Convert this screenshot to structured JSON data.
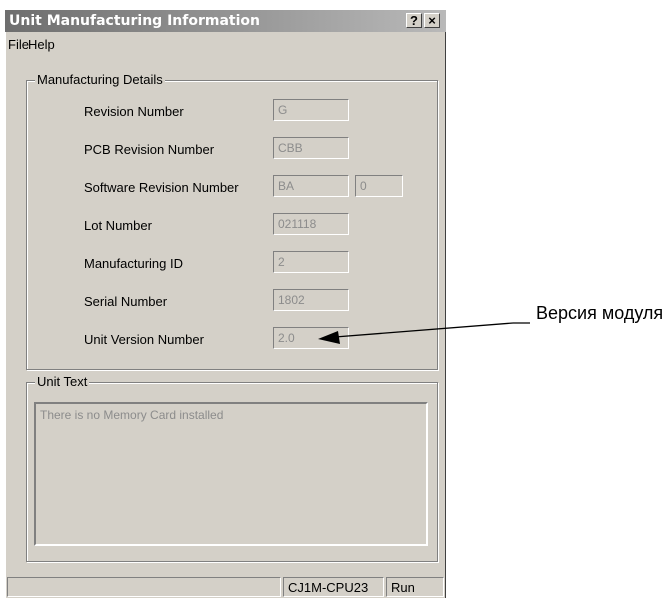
{
  "window": {
    "title": "Unit Manufacturing Information",
    "help_button": "?",
    "close_button": "×"
  },
  "menu": [
    "File",
    "Help"
  ],
  "manufacturing_details": {
    "legend": "Manufacturing Details",
    "rows": [
      {
        "label": "Revision Number",
        "value": "G"
      },
      {
        "label": "PCB Revision Number",
        "value": "CBB"
      },
      {
        "label": "Software Revision Number",
        "value": "BA",
        "extra_value": "0"
      },
      {
        "label": "Lot Number",
        "value": "021118"
      },
      {
        "label": "Manufacturing ID",
        "value": "2"
      },
      {
        "label": "Serial Number",
        "value": "1802"
      },
      {
        "label": "Unit Version Number",
        "value": "2.0"
      }
    ]
  },
  "unit_text": {
    "legend": "Unit Text",
    "content": "There is no Memory Card installed"
  },
  "status_bar": {
    "model": "CJ1M-CPU23",
    "mode": "Run"
  },
  "annotation": {
    "text": "Версия модуля"
  }
}
